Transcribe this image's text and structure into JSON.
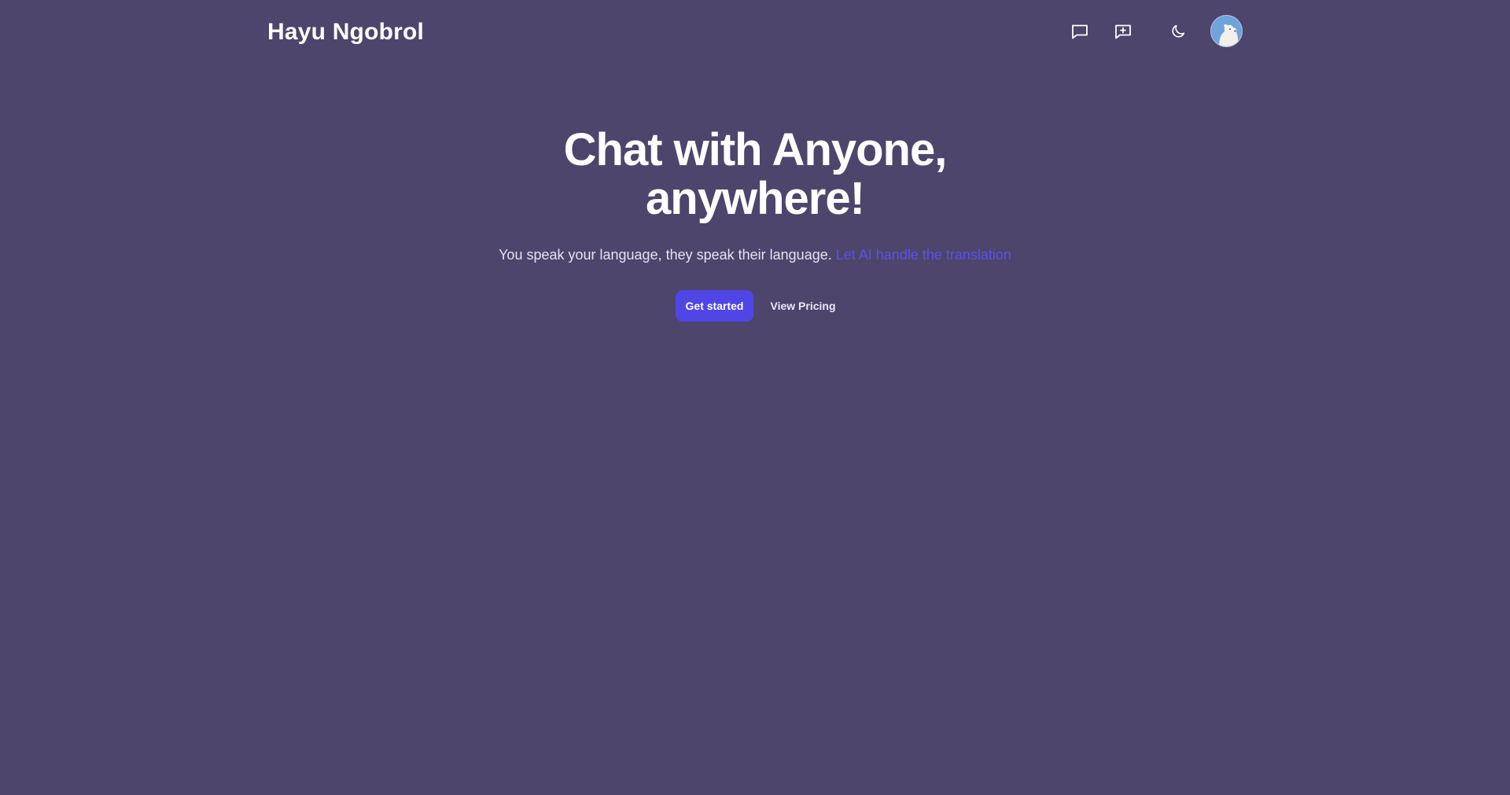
{
  "header": {
    "brand": "Hayu Ngobrol",
    "icons": {
      "chat": "chat-bubble-icon",
      "new_chat": "chat-plus-icon",
      "theme": "moon-icon"
    },
    "avatar": "user-avatar"
  },
  "hero": {
    "title_line1": "Chat with Anyone,",
    "title_line2": "anywhere!",
    "subtitle": "You speak your language, they speak their language.",
    "subtitle_accent": "Let AI handle the translation",
    "primary_button": "Get started",
    "secondary_link": "View Pricing"
  },
  "colors": {
    "background": "#4d456b",
    "accent": "#4f46e5",
    "accent_text": "#5b50e8",
    "text": "#ffffff"
  }
}
